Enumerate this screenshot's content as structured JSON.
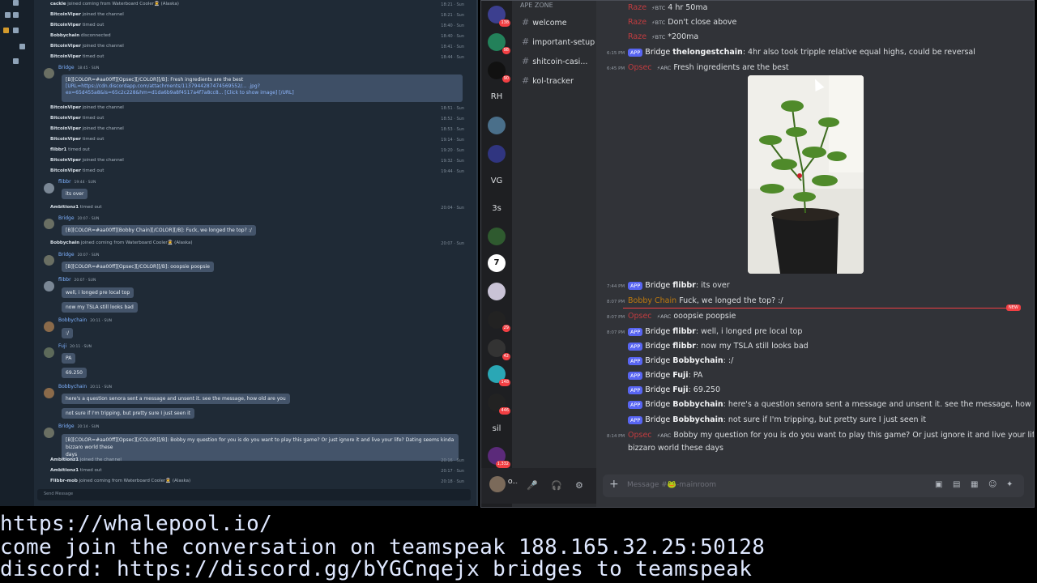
{
  "left_panel": {
    "events": [
      {
        "user": "cackle",
        "text": "joined coming from Waterboard Cooler🧑‍🚀 (Alaska)",
        "time": "18:21 · Sun"
      },
      {
        "user": "BitcoinViper",
        "text": "joined the channel",
        "time": "18:21 · Sun"
      },
      {
        "user": "BitcoinViper",
        "text": "timed out",
        "time": "18:40 · Sun"
      },
      {
        "user": "Bobbychain",
        "text": "disconnected",
        "time": "18:40 · Sun"
      },
      {
        "user": "BitcoinViper",
        "text": "joined the channel",
        "time": "18:41 · Sun"
      },
      {
        "user": "BitcoinViper",
        "text": "timed out",
        "time": "18:44 · Sun"
      }
    ],
    "bridge1": {
      "name": "Bridge",
      "meta": "18:45 · SUN",
      "text1": "[B][COLOR=#aa00ff][Opsec][/COLOR][/B]: Fresh ingredients are the best",
      "text2": "[URL=https://cdn.discordapp.com/attachments/1137944287474569552/... .jpg?",
      "text3": "ex=65d455a8&is=65c2c228&hm=d1da6b9a8f4517a4f7a8cc8... [Click to show image] [/URL]"
    },
    "events2": [
      {
        "user": "BitcoinViper",
        "text": "joined the channel",
        "time": "18:51 · Sun"
      },
      {
        "user": "BitcoinViper",
        "text": "timed out",
        "time": "18:52 · Sun"
      },
      {
        "user": "BitcoinViper",
        "text": "joined the channel",
        "time": "18:53 · Sun"
      },
      {
        "user": "BitcoinViper",
        "text": "timed out",
        "time": "19:14 · Sun"
      },
      {
        "user": "flibbr1",
        "text": "timed out",
        "time": "19:20 · Sun"
      },
      {
        "user": "BitcoinViper",
        "text": "joined the channel",
        "time": "19:32 · Sun"
      },
      {
        "user": "BitcoinViper",
        "text": "timed out",
        "time": "19:44 · Sun"
      }
    ],
    "flibbr1": {
      "name": "flibbr",
      "meta": "19:44 · SUN",
      "text": "its over"
    },
    "amb1": {
      "user": "Ambitionz1",
      "text": "timed out",
      "time": "20:04 · Sun"
    },
    "bridge2": {
      "name": "Bridge",
      "meta": "20:07 · SUN",
      "text": "[B][COLOR=#aa00ff][Bobby Chain][/COLOR][/B]: Fuck, we longed the top? :/"
    },
    "bobbyjoin": {
      "user": "Bobbychain",
      "text": "joined coming from Waterboard Cooler🧑‍🚀 (Alaska)",
      "time": "20:07 · Sun"
    },
    "bridge3": {
      "name": "Bridge",
      "meta": "20:07 · SUN",
      "text": "[B][COLOR=#aa00ff][Opsec][/COLOR][/B]: ooopsie poopsie"
    },
    "flibbr2": {
      "name": "flibbr",
      "meta": "20:07 · SUN",
      "text1": "well, i longed pre local top",
      "text2": "now my TSLA still looks bad"
    },
    "bobby1": {
      "name": "Bobbychain",
      "meta": "20:11 · SUN",
      "text": ":/"
    },
    "fuji": {
      "name": "Fuji",
      "meta": "20:11 · SUN",
      "text1": "PA",
      "text2": "69.250"
    },
    "bobby2": {
      "name": "Bobbychain",
      "meta": "20:11 · SUN",
      "text1": "here's a question senora sent a message and unsent it. see the message, how old are you",
      "text2": "not sure if I'm tripping, but pretty sure I just seen it"
    },
    "bridge4": {
      "name": "Bridge",
      "meta": "20:14 · SUN",
      "text1": "[B][COLOR=#aa00ff][Opsec][/COLOR][/B]: Bobby my question for you is do you want to play this game? Or just ignore it and live your life? Dating seems kinda bizzaro world these",
      "text2": "days"
    },
    "events3": [
      {
        "user": "Ambitionz1",
        "text": "joined the channel",
        "time": "20:16 · Sun"
      },
      {
        "user": "Ambitionz1",
        "text": "timed out",
        "time": "20:17 · Sun"
      },
      {
        "user": "Flibbr-mob",
        "text": "joined coming from Waterboard Cooler🧑‍🚀 (Alaska)",
        "time": "20:18 · Sun"
      }
    ],
    "input_placeholder": "Send Message"
  },
  "discord": {
    "server_name": "APE ZONE",
    "channels": [
      "welcome",
      "important-setup",
      "shitcoin-casi...",
      "kol-tracker"
    ],
    "guilds": [
      {
        "label": "",
        "badge": "138"
      },
      {
        "label": "",
        "badge": "98"
      },
      {
        "label": "",
        "badge": "90"
      },
      {
        "label": "RH",
        "badge": ""
      },
      {
        "label": "",
        "badge": ""
      },
      {
        "label": "",
        "badge": ""
      },
      {
        "label": "VG",
        "badge": ""
      },
      {
        "label": "3s",
        "badge": ""
      },
      {
        "label": "",
        "badge": ""
      },
      {
        "label": "7",
        "badge": ""
      },
      {
        "label": "",
        "badge": ""
      },
      {
        "label": "",
        "badge": "29"
      },
      {
        "label": "",
        "badge": "42"
      },
      {
        "label": "",
        "badge": "148"
      },
      {
        "label": "",
        "badge": "446"
      },
      {
        "label": "sil",
        "badge": ""
      },
      {
        "label": "",
        "badge": "1,332"
      }
    ],
    "messages": {
      "r1": {
        "name": "Raze",
        "text": "4 hr 50ma"
      },
      "r2": {
        "name": "Raze",
        "text": "Don't close above"
      },
      "r3": {
        "name": "Raze",
        "text": "*200ma"
      },
      "btc": "BTC",
      "arc": "ARC",
      "app": "APP",
      "bridge": "Bridge",
      "m4": {
        "time": "6:15 PM",
        "user": "thelongestchain",
        "text": ": 4hr also took tripple relative equal highs, could be reversal"
      },
      "m5": {
        "time": "6:45 PM",
        "user": "Opsec",
        "text": "Fresh ingredients are the best"
      },
      "m6": {
        "time": "7:44 PM",
        "user": "flibbr",
        "text": ": its over"
      },
      "m7": {
        "time": "8:07 PM",
        "user": "Bobby Chain",
        "text": "Fuck, we longed the top? :/"
      },
      "m8": {
        "time": "8:07 PM",
        "user": "Opsec",
        "text": "ooopsie poopsie"
      },
      "m9": {
        "time": "8:07 PM",
        "user": "flibbr",
        "text": ": well, i longed pre local top"
      },
      "m10": {
        "user": "flibbr",
        "text": ": now my TSLA still looks bad"
      },
      "m11": {
        "user": "Bobbychain",
        "text": ": :/"
      },
      "m12": {
        "user": "Fuji",
        "text": ": PA"
      },
      "m13": {
        "user": "Fuji",
        "text": ": 69.250"
      },
      "m14": {
        "user": "Bobbychain",
        "text": ": here's a question senora sent a message and unsent it. see the message, how old are you"
      },
      "m15": {
        "user": "Bobbychain",
        "text": ": not sure if I'm tripping, but pretty sure I just seen it"
      },
      "m16": {
        "time": "8:14 PM",
        "user": "Opsec",
        "text1": "Bobby my question for you is do you want to play this game? Or just ignore it and live your life? Dating seems kinda",
        "text2": "bizzaro world these days"
      }
    },
    "new_badge": "NEW",
    "composer_placeholder": "Message #🐸-mainroom",
    "user_short": "O..."
  },
  "banner": {
    "line1": "https://whalepool.io/",
    "line2": "come join the conversation on teamspeak 188.165.32.25:50128",
    "line3": "discord: https://discord.gg/bYGCnqejx bridges to teamspeak"
  }
}
